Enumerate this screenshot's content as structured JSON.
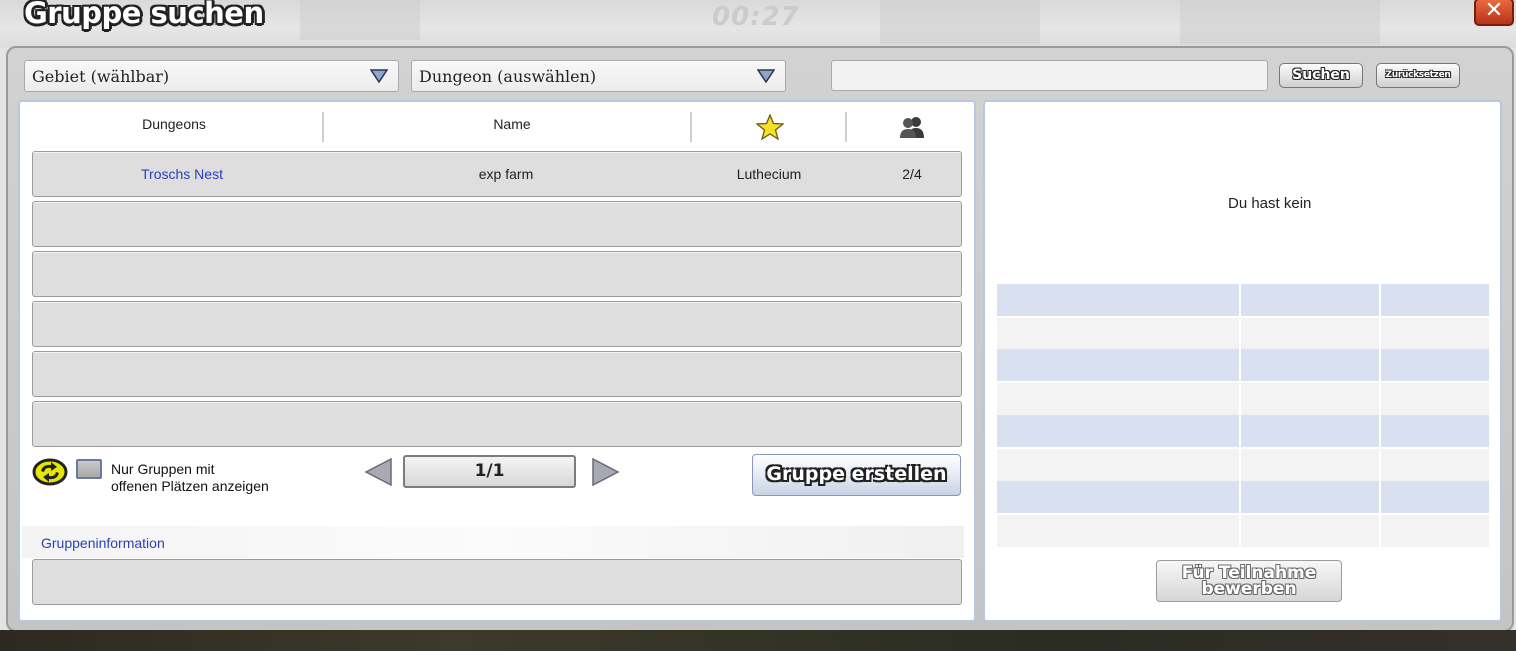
{
  "window": {
    "title": "Gruppe suchen",
    "timer": "00:27",
    "close_label": "✕"
  },
  "filters": {
    "area_dropdown": "Gebiet (wählbar)",
    "dungeon_dropdown": "Dungeon (auswählen)",
    "search_value": "",
    "search_button": "Suchen",
    "reset_button": "Zurücksetzen"
  },
  "table": {
    "columns": [
      "Dungeons",
      "Name"
    ],
    "column_icons": [
      "star-icon",
      "group-members-icon"
    ],
    "rows": [
      {
        "dungeon": "Troschs Nest",
        "name": "exp farm",
        "leader": "Luthecium",
        "members": "2/4"
      }
    ]
  },
  "controls": {
    "open_slots_label_line1": "Nur Gruppen mit",
    "open_slots_label_line2": "offenen Plätzen anzeigen",
    "page_indicator": "1/1",
    "create_group_button": "Gruppe erstellen"
  },
  "group_info": {
    "label": "Gruppeninformation"
  },
  "right_panel": {
    "no_group_text": "Du hast kein",
    "apply_button_line1": "Für Teilnahme",
    "apply_button_line2": "bewerben"
  },
  "colors": {
    "link": "#2b3fb8",
    "panel_border": "#b9c7e2",
    "stripe_blue": "#d9e1f0"
  }
}
